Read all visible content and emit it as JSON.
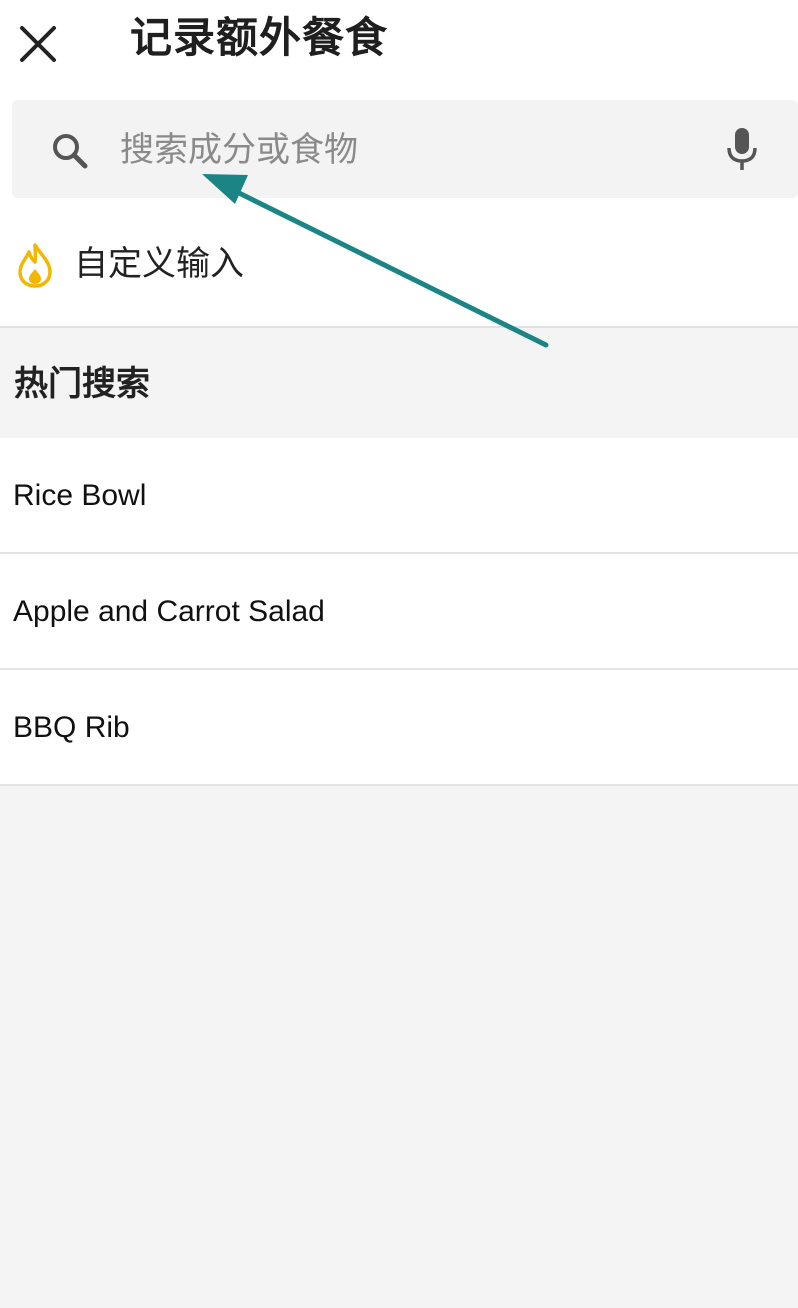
{
  "header": {
    "title": "记录额外餐食",
    "close_icon": "close-icon"
  },
  "search": {
    "placeholder": "搜索成分或食物",
    "value": "",
    "search_icon": "search-icon",
    "mic_icon": "microphone-icon"
  },
  "custom_entry": {
    "label": "自定义输入",
    "icon": "flame-icon",
    "icon_color": "#f2b705"
  },
  "popular": {
    "title": "热门搜索",
    "items": [
      {
        "label": "Rice Bowl"
      },
      {
        "label": "Apple and Carrot Salad"
      },
      {
        "label": "BBQ Rib"
      }
    ]
  },
  "annotation": {
    "arrow_color": "#1b8585"
  }
}
